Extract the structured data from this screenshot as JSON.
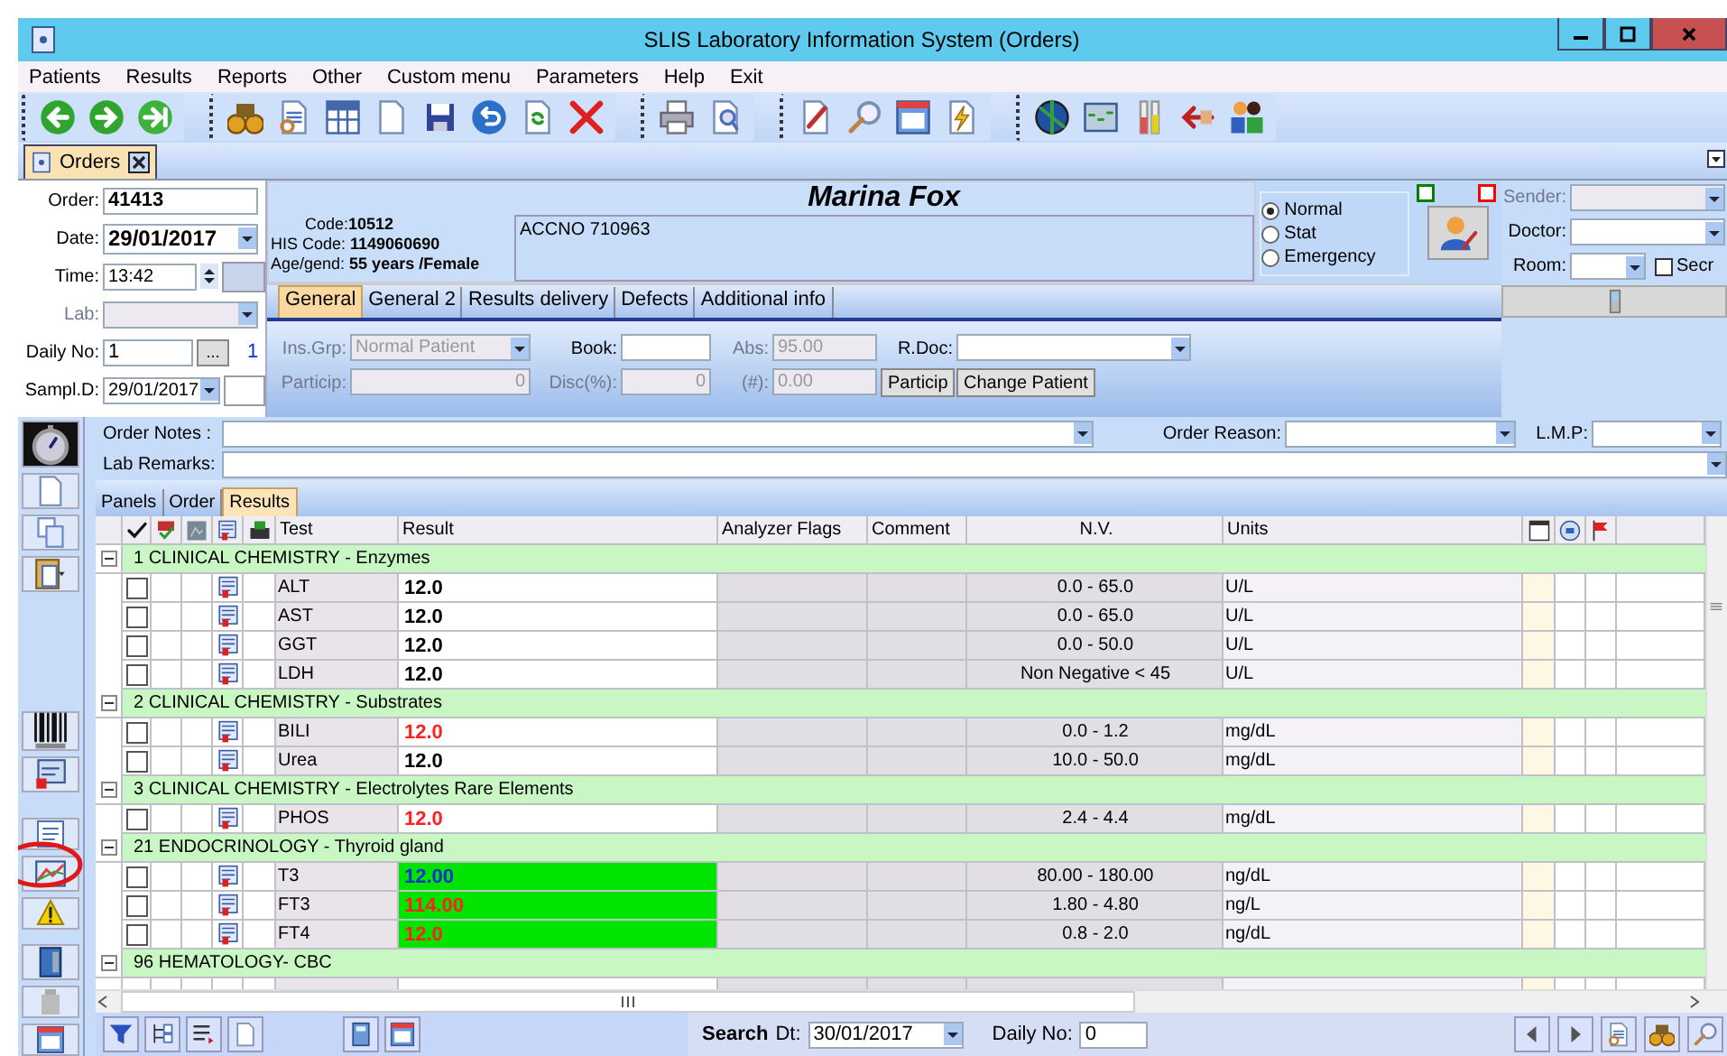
{
  "window": {
    "title": "SLIS Laboratory Information System (Orders)"
  },
  "menu": [
    "Patients",
    "Results",
    "Reports",
    "Other",
    "Custom menu",
    "Parameters",
    "Help",
    "Exit"
  ],
  "document_tabs": [
    {
      "label": "Orders",
      "selected": true
    }
  ],
  "order": {
    "order_label": "Order:",
    "order_no": "41413",
    "date_label": "Date:",
    "date": "29/01/2017",
    "time_label": "Time:",
    "time": "13:42",
    "lab_label": "Lab:",
    "lab_disabled": true,
    "daily_label": "Daily No:",
    "daily_no": "1",
    "daily_button": "...",
    "daily_count": "1",
    "sample_label": "Sampl.D:",
    "sample_date": "29/01/2017"
  },
  "patient": {
    "name": "Marina Fox",
    "code_label": "Code:",
    "code": "10512",
    "his_label": "HIS Code:",
    "his_code": "1149060690",
    "age_label": "Age/gend:",
    "age_gender": "55 years /Female",
    "accno": "ACCNO 710963"
  },
  "priority": [
    {
      "label": "Normal",
      "selected": true
    },
    {
      "label": "Stat",
      "selected": false
    },
    {
      "label": "Emergency",
      "selected": false
    }
  ],
  "flags": [
    {
      "color": "#008000",
      "checked": false
    },
    {
      "color": "#ff0000",
      "checked": false
    }
  ],
  "referral": {
    "sender_label": "Sender:",
    "sender_disabled": true,
    "doctor_label": "Doctor:",
    "room_label": "Room:",
    "secr": {
      "label": "Secr",
      "checked": false
    }
  },
  "info_tabs": [
    {
      "label": "General",
      "selected": true
    },
    {
      "label": "General 2",
      "selected": false
    },
    {
      "label": "Results delivery",
      "selected": false
    },
    {
      "label": "Defects",
      "selected": false
    },
    {
      "label": "Additional info",
      "selected": false
    }
  ],
  "insurance": [
    {
      "kind": "select",
      "label": "Ins.Grp:",
      "value": "Normal Patient",
      "disabled": true
    },
    {
      "kind": "input",
      "label": "Book:",
      "disabled": false
    },
    {
      "kind": "input",
      "label": "Abs:",
      "value": "95.00",
      "disabled": true
    },
    {
      "kind": "select",
      "label": "R.Doc:",
      "disabled": false
    },
    {
      "kind": "number",
      "label": "Particip:",
      "value": "0",
      "disabled": true
    },
    {
      "kind": "number",
      "label": "Disc(%):",
      "value": "0",
      "disabled": true
    },
    {
      "kind": "input",
      "label": "(#):",
      "value": "0.00",
      "disabled": true
    },
    {
      "kind": "button",
      "label": "Particip",
      "disabled": false
    },
    {
      "kind": "button",
      "label": "Change Patient",
      "disabled": false
    }
  ],
  "notes": {
    "order_notes_label": "Order Notes :",
    "order_reason_label": "Order Reason:",
    "lmp_label": "L.M.P:",
    "lab_remarks_label": "Lab Remarks:"
  },
  "result_tabs": [
    {
      "label": "Panels",
      "selected": false
    },
    {
      "label": "Order",
      "selected": false
    },
    {
      "label": "Results",
      "selected": true
    }
  ],
  "table": {
    "columns": [
      "Test",
      "Result",
      "Analyzer Flags",
      "Comment",
      "N.V.",
      "Units"
    ],
    "groups": [
      {
        "title": "1 CLINICAL CHEMISTRY - Enzymes",
        "expanded": true,
        "rows": [
          {
            "test": "ALT",
            "result": "12.0",
            "color": "#000000",
            "highlight": false,
            "nv": "0.0 - 65.0",
            "units": "U/L",
            "checked": false
          },
          {
            "test": "AST",
            "result": "12.0",
            "color": "#000000",
            "highlight": false,
            "nv": "0.0 - 65.0",
            "units": "U/L",
            "checked": false
          },
          {
            "test": "GGT",
            "result": "12.0",
            "color": "#000000",
            "highlight": false,
            "nv": "0.0 - 50.0",
            "units": "U/L",
            "checked": false
          },
          {
            "test": "LDH",
            "result": "12.0",
            "color": "#000000",
            "highlight": false,
            "nv": "Non Negative < 45",
            "units": "U/L",
            "checked": false
          }
        ]
      },
      {
        "title": "2 CLINICAL CHEMISTRY - Substrates",
        "expanded": true,
        "rows": [
          {
            "test": "BILI",
            "result": "12.0",
            "color": "#ff2020",
            "highlight": false,
            "nv": "0.0 - 1.2",
            "units": "mg/dL",
            "checked": false
          },
          {
            "test": "Urea",
            "result": "12.0",
            "color": "#000000",
            "highlight": false,
            "nv": "10.0 - 50.0",
            "units": "mg/dL",
            "checked": false
          }
        ]
      },
      {
        "title": "3 CLINICAL CHEMISTRY - Electrolytes Rare Elements",
        "expanded": true,
        "rows": [
          {
            "test": "PHOS",
            "result": "12.0",
            "color": "#ff2020",
            "highlight": false,
            "nv": "2.4 - 4.4",
            "units": "mg/dL",
            "checked": false
          }
        ]
      },
      {
        "title": "21 ENDOCRINOLOGY - Thyroid gland",
        "expanded": true,
        "rows": [
          {
            "test": "T3",
            "result": "12.00",
            "color": "#1030d0",
            "highlight": true,
            "nv": "80.00 - 180.00",
            "units": "ng/dL",
            "checked": false
          },
          {
            "test": "FT3",
            "result": "114.00",
            "color": "#ff2020",
            "highlight": true,
            "nv": "1.80 - 4.80",
            "units": "ng/L",
            "checked": false
          },
          {
            "test": "FT4",
            "result": "12.0",
            "color": "#ff2020",
            "highlight": true,
            "nv": "0.8 - 2.0",
            "units": "ng/dL",
            "checked": false
          }
        ]
      },
      {
        "title": "96 HEMATOLOGY- CBC",
        "expanded": true
      }
    ]
  },
  "search": {
    "label": "Search",
    "date_label": "Dt:",
    "date": "30/01/2017",
    "daily_label": "Daily No:",
    "daily_no": "0"
  }
}
